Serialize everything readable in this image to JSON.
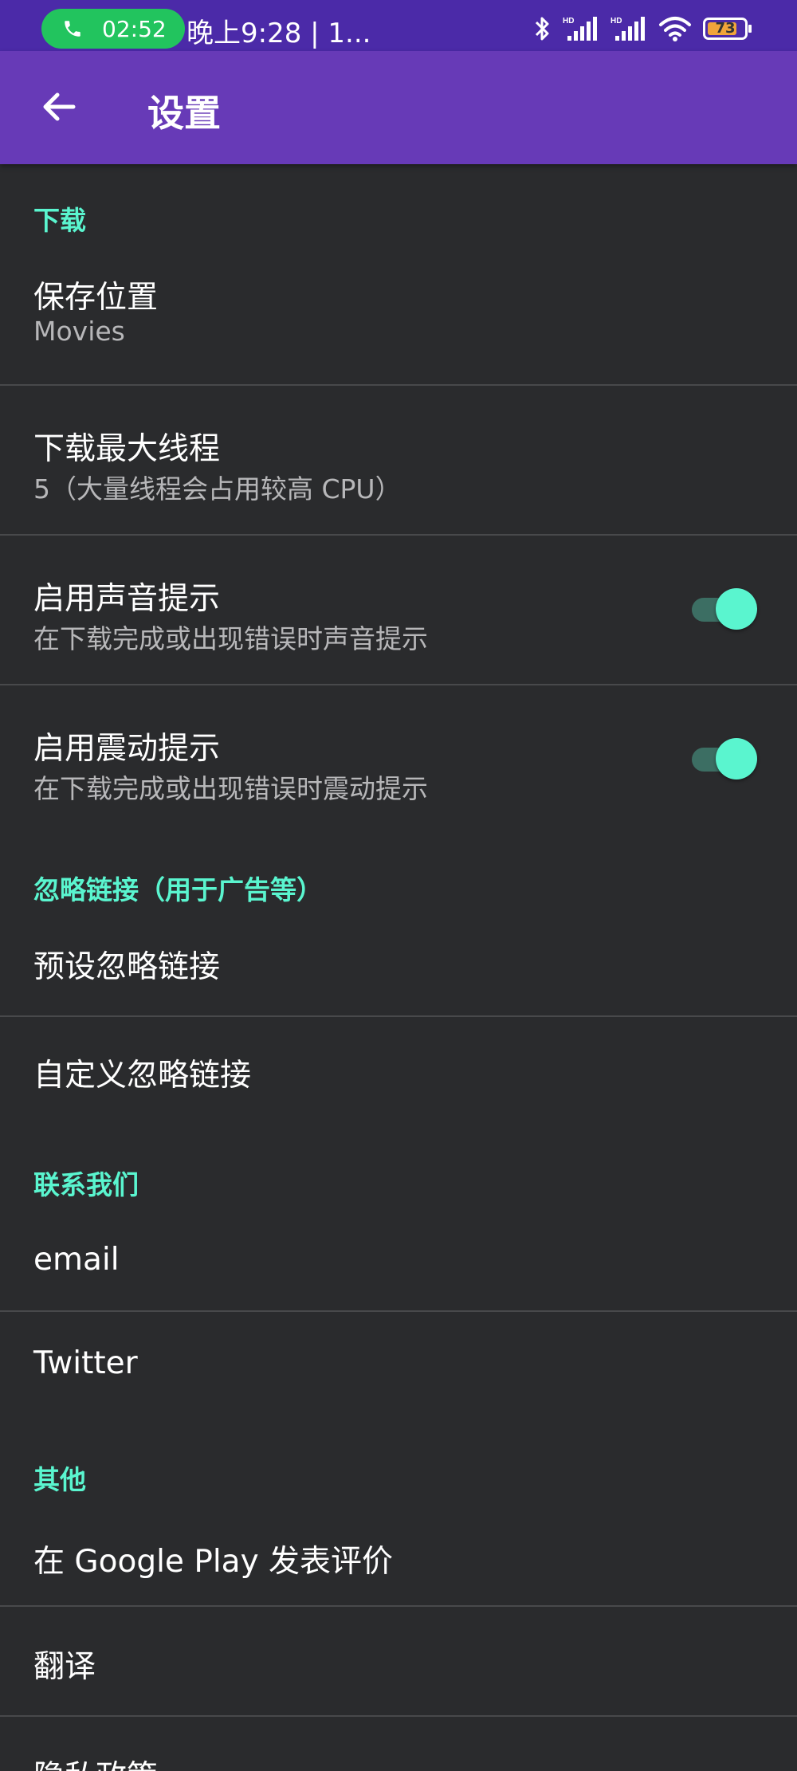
{
  "status_bar": {
    "call_time": "02:52",
    "time_text": "晚上9:28 | 1...",
    "battery": "73",
    "signal_label_1": "HD",
    "signal_label_2": "HD"
  },
  "app_bar": {
    "title": "设置"
  },
  "sections": {
    "download": {
      "header": "下载",
      "save_location": {
        "title": "保存位置",
        "value": "Movies"
      },
      "max_threads": {
        "title": "下载最大线程",
        "value": "5（大量线程会占用较高 CPU）"
      },
      "sound": {
        "title": "启用声音提示",
        "desc": "在下载完成或出现错误时声音提示",
        "enabled": true
      },
      "vibration": {
        "title": "启用震动提示",
        "desc": "在下载完成或出现错误时震动提示",
        "enabled": true
      }
    },
    "ignore": {
      "header": "忽略链接（用于广告等）",
      "preset": "预设忽略链接",
      "custom": "自定义忽略链接"
    },
    "contact": {
      "header": "联系我们",
      "email": "email",
      "twitter": "Twitter"
    },
    "other": {
      "header": "其他",
      "rate": "在 Google Play 发表评价",
      "translate": "翻译",
      "privacy": "隐私政策"
    }
  },
  "colors": {
    "status_bar": "#4b2aa8",
    "app_bar": "#673ab7",
    "background": "#2a2b2d",
    "accent": "#5af5cf",
    "call_pill": "#22c45e"
  }
}
